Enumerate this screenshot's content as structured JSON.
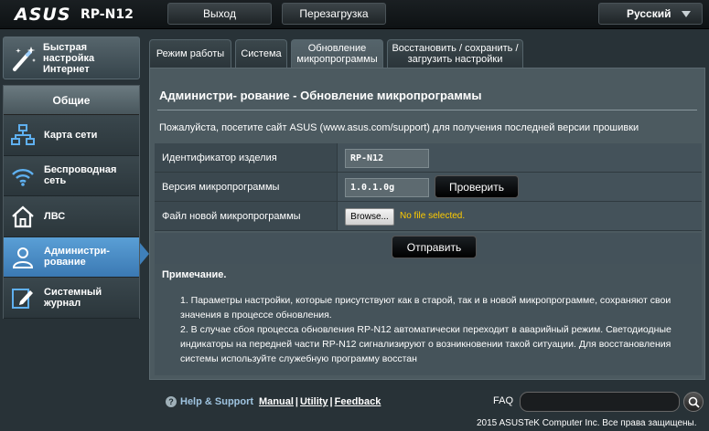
{
  "header": {
    "brand": "ASUS",
    "model": "RP-N12",
    "logout_label": "Выход",
    "reboot_label": "Перезагрузка",
    "language": "Русский"
  },
  "sidebar": {
    "quick_setup_label": "Быстрая настройка Интернет",
    "section_title": "Общие",
    "items": [
      {
        "label": "Карта сети",
        "icon": "network-map-icon"
      },
      {
        "label": "Беспроводная сеть",
        "icon": "wifi-icon"
      },
      {
        "label": "ЛВС",
        "icon": "home-icon"
      },
      {
        "label": "Администри- рование",
        "icon": "admin-user-icon",
        "active": true
      },
      {
        "label": "Системный журнал",
        "icon": "log-edit-icon"
      }
    ]
  },
  "tabs": [
    {
      "label": "Режим работы"
    },
    {
      "label": "Система"
    },
    {
      "label": "Обновление микропрограммы",
      "active": true
    },
    {
      "label": "Восстановить / сохранить / загрузить настройки"
    }
  ],
  "main": {
    "title": "Администри- рование - Обновление микропрограммы",
    "description": "Пожалуйста, посетите сайт ASUS (www.asus.com/support) для получения последней версии прошивки",
    "product_id_label": "Идентификатор изделия",
    "product_id_value": "RP-N12",
    "firmware_version_label": "Версия микропрограммы",
    "firmware_version_value": "1.0.1.0g",
    "check_label": "Проверить",
    "new_firmware_label": "Файл новой микропрограммы",
    "browse_label": "Browse...",
    "no_file_text": "No file selected.",
    "submit_label": "Отправить",
    "note_title": "Примечание.",
    "notes": [
      "1. Параметры настройки, которые присутствуют как в старой, так и в новой микропрограмме, сохраняют свои значения в процессе обновления.",
      "2. В случае сбоя процесса обновления RP-N12 автоматически переходит в аварийный режим. Светодиодные индикаторы на передней части RP-N12 сигнализируют о возникновении такой ситуации. Для восстановления системы используйте служебную программу восстан"
    ]
  },
  "footer": {
    "help_label": "Help & Support",
    "manual_label": "Manual",
    "utility_label": "Utility",
    "feedback_label": "Feedback",
    "faq_label": "FAQ",
    "faq_placeholder": "",
    "copyright": "2015 ASUSTeK Computer Inc. Все права защищены."
  },
  "colors": {
    "accent_active": "#3f80bb",
    "warning_text": "#ffcc00",
    "background": "#283237"
  }
}
